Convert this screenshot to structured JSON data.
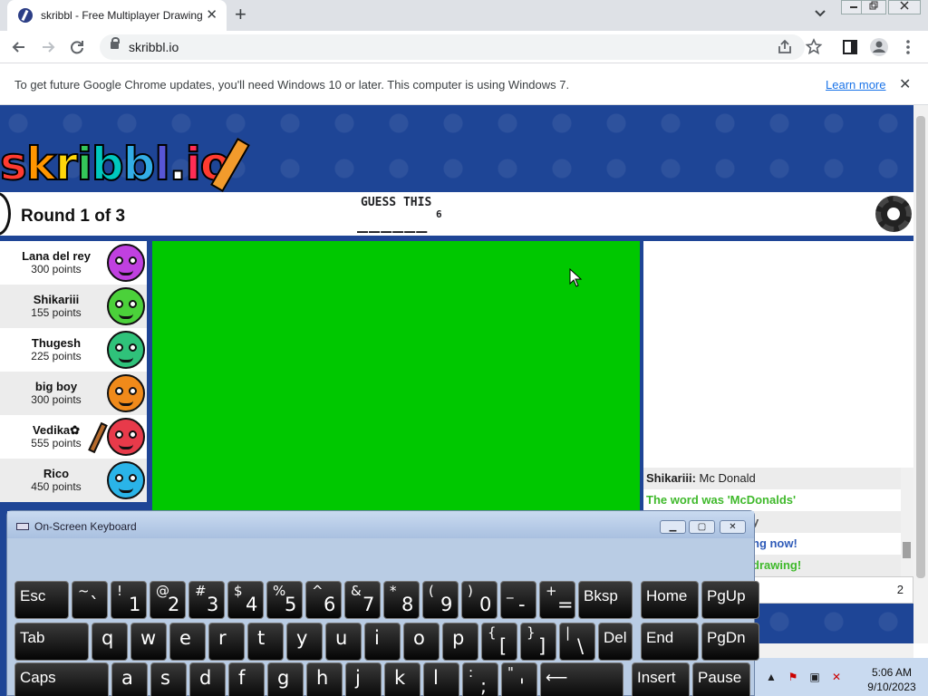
{
  "browser": {
    "tab_title": "skribbl - Free Multiplayer Drawing",
    "tab_close": "✕",
    "new_tab": "+",
    "url": "skribbl.io",
    "info_text": "To get future Google Chrome updates, you'll need Windows 10 or later. This computer is using Windows 7.",
    "info_link": "Learn more",
    "info_close": "✕"
  },
  "game": {
    "logo_letters": [
      "s",
      "k",
      "r",
      "i",
      "b",
      "b",
      "l",
      ".",
      "i",
      "o"
    ],
    "logo_colors": [
      "#ff3b30",
      "#ff9500",
      "#ffd60a",
      "#34c759",
      "#00c7be",
      "#32ade6",
      "#5856d6",
      "#ffffff",
      "#ff2d55",
      "#ff3b30"
    ],
    "round": "Round 1 of 3",
    "guess_label": "GUESS THIS",
    "word_blanks": "______",
    "word_length": "6",
    "players": [
      {
        "name": "Lana del rey",
        "points": "300 points",
        "color": "#c040e0"
      },
      {
        "name": "Shikariii",
        "points": "155 points",
        "color": "#4bd13a"
      },
      {
        "name": "Thugesh",
        "points": "225 points",
        "color": "#2fc27a"
      },
      {
        "name": "big boy",
        "points": "300 points",
        "color": "#f08a1a"
      },
      {
        "name": "Vedika✿",
        "points": "555 points",
        "color": "#e83a4a"
      },
      {
        "name": "Rico",
        "points": "450 points",
        "color": "#2ab4e8"
      }
    ],
    "canvas_color": "#00c800",
    "chat": [
      {
        "speaker": "Shikariii:",
        "text": "Mc Donald",
        "color": "#222222"
      },
      {
        "speaker": "",
        "text": "The word was 'McDonalds'",
        "color": "#3fb92b"
      },
      {
        "speaker": "",
        "text": "y",
        "color": "#555555"
      },
      {
        "speaker": "",
        "text": "ng now!",
        "color": "#2f5bb8"
      },
      {
        "speaker": "",
        "text": "drawing!",
        "color": "#3fb92b"
      }
    ],
    "chat_input_count": "2"
  },
  "osk": {
    "title": "On-Screen Keyboard",
    "rows": [
      [
        {
          "main": "Esc",
          "word": true
        },
        {
          "shift": "~",
          "main": "`"
        },
        {
          "shift": "!",
          "main": "1"
        },
        {
          "shift": "@",
          "main": "2"
        },
        {
          "shift": "#",
          "main": "3"
        },
        {
          "shift": "$",
          "main": "4"
        },
        {
          "shift": "%",
          "main": "5"
        },
        {
          "shift": "^",
          "main": "6"
        },
        {
          "shift": "&",
          "main": "7"
        },
        {
          "shift": "*",
          "main": "8"
        },
        {
          "shift": "(",
          "main": "9"
        },
        {
          "shift": ")",
          "main": "0"
        },
        {
          "shift": "_",
          "main": "-"
        },
        {
          "shift": "+",
          "main": "="
        },
        {
          "main": "Bksp",
          "word": true
        },
        {
          "main": "Home",
          "word": true
        },
        {
          "main": "PgUp",
          "word": true
        }
      ],
      [
        {
          "main": "Tab",
          "word": true
        },
        {
          "main": "q"
        },
        {
          "main": "w"
        },
        {
          "main": "e"
        },
        {
          "main": "r"
        },
        {
          "main": "t"
        },
        {
          "main": "y"
        },
        {
          "main": "u"
        },
        {
          "main": "i"
        },
        {
          "main": "o"
        },
        {
          "main": "p"
        },
        {
          "shift": "{",
          "main": "["
        },
        {
          "shift": "}",
          "main": "]"
        },
        {
          "shift": "|",
          "main": "\\"
        },
        {
          "main": "Del",
          "word": true
        },
        {
          "main": "End",
          "word": true
        },
        {
          "main": "PgDn",
          "word": true
        }
      ],
      [
        {
          "main": "Caps",
          "word": true
        },
        {
          "main": "a"
        },
        {
          "main": "s"
        },
        {
          "main": "d"
        },
        {
          "main": "f"
        },
        {
          "main": "g"
        },
        {
          "main": "h"
        },
        {
          "main": "j"
        },
        {
          "main": "k"
        },
        {
          "main": "l"
        },
        {
          "shift": ":",
          "main": ";"
        },
        {
          "shift": "\"",
          "main": "'"
        },
        {
          "main": "⟵",
          "word": true
        },
        {
          "main": "Insert",
          "word": true
        },
        {
          "main": "Pause",
          "word": true
        }
      ]
    ]
  },
  "taskbar": {
    "time": "5:06 AM",
    "date": "9/10/2023"
  }
}
